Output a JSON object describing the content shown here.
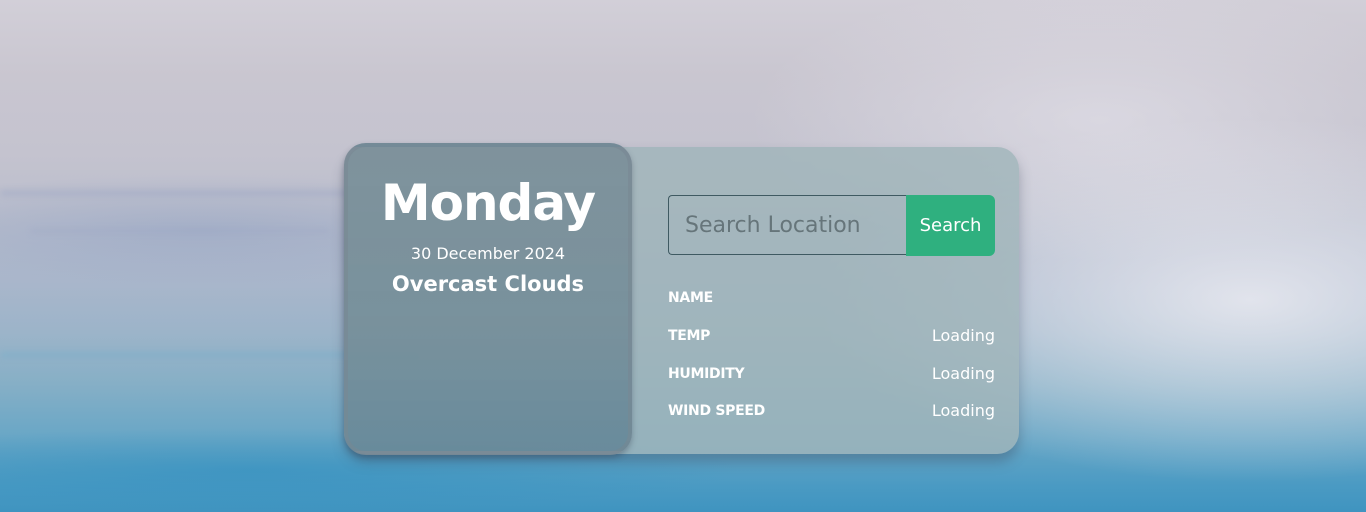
{
  "weather": {
    "day": "Monday",
    "date": "30 December 2024",
    "description": "Overcast Clouds"
  },
  "search": {
    "placeholder": "Search Location",
    "value": "",
    "button_label": "Search"
  },
  "details": [
    {
      "label": "NAME",
      "value": ""
    },
    {
      "label": "TEMP",
      "value": "Loading"
    },
    {
      "label": "HUMIDITY",
      "value": "Loading"
    },
    {
      "label": "WIND SPEED",
      "value": "Loading"
    }
  ],
  "colors": {
    "accent": "#2fb07f",
    "card": "#a0b4ba",
    "text": "#ffffff"
  }
}
